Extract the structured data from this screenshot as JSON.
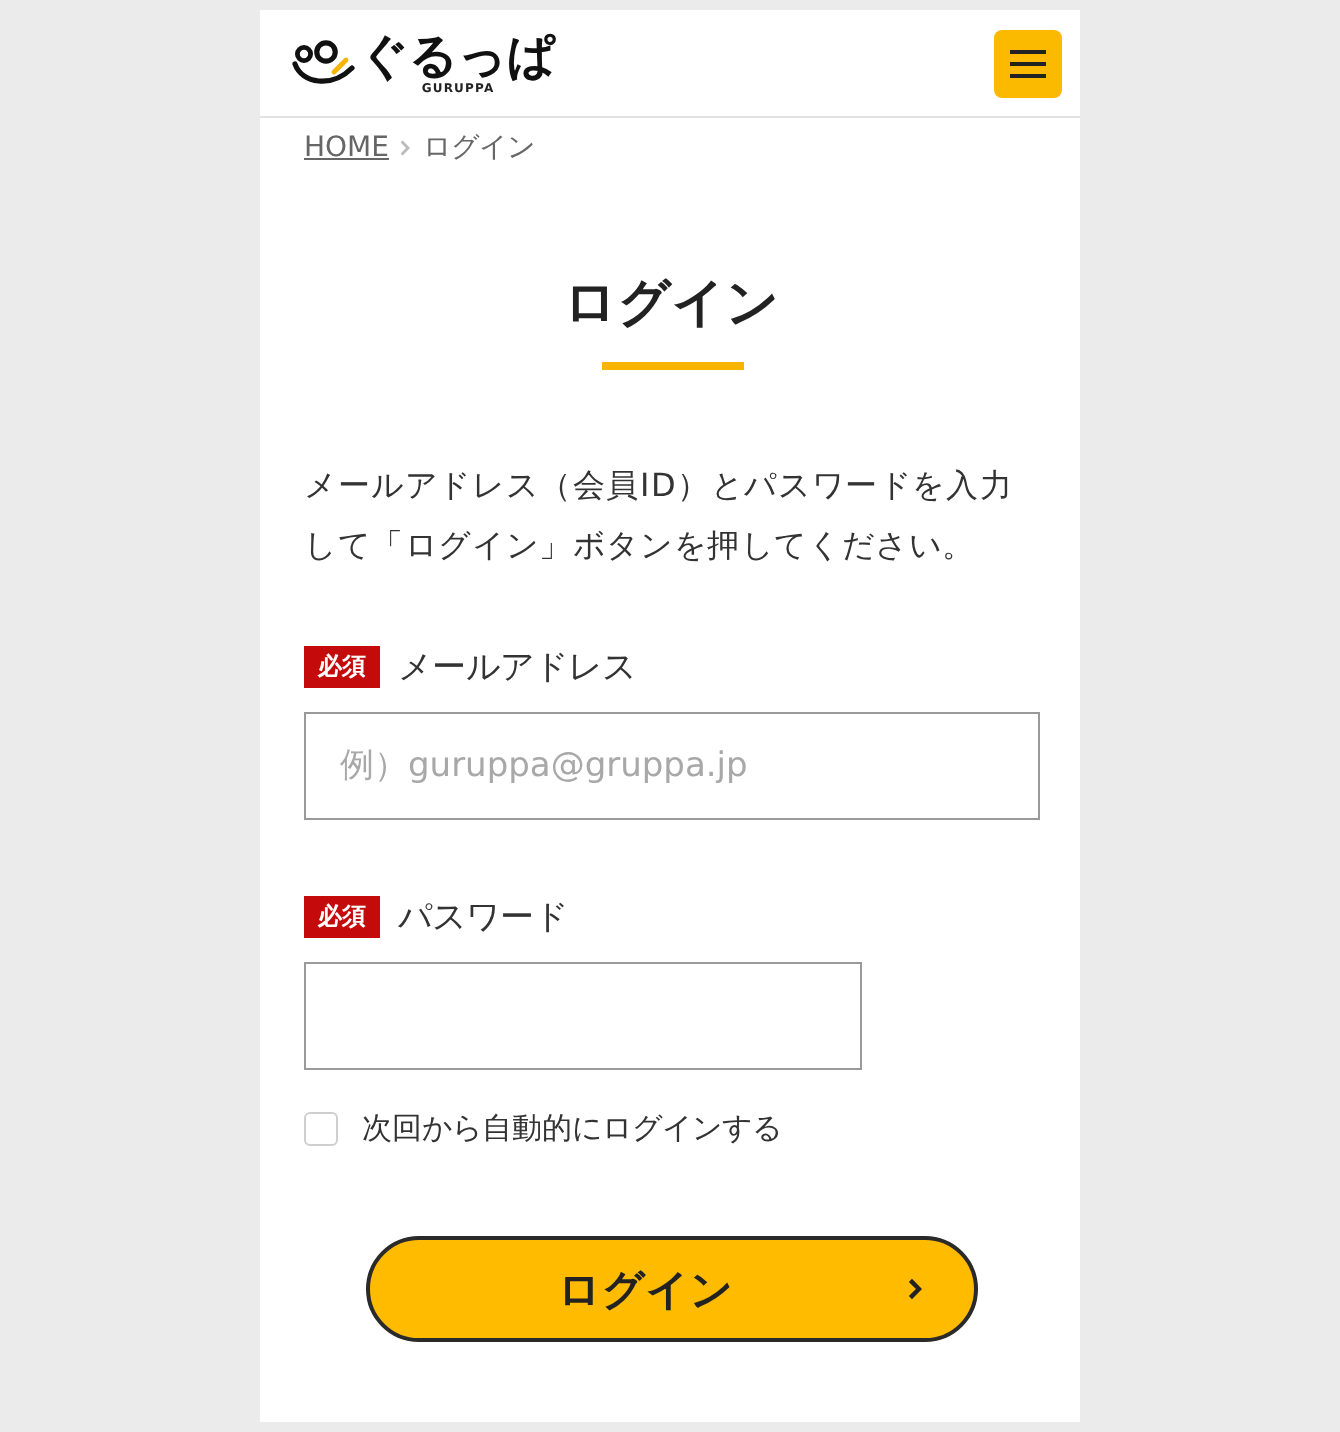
{
  "header": {
    "logo": {
      "text": "ぐるっぱ",
      "subtitle": "GURUPPA"
    }
  },
  "breadcrumb": [
    {
      "label": "HOME",
      "current": false
    },
    {
      "label": "ログイン",
      "current": true
    }
  ],
  "title": "ログイン",
  "intro": "メールアドレス（会員ID）とパスワードを入力して「ログイン」ボタンを押してください。",
  "fields": [
    {
      "kind": "email",
      "badge": "必須",
      "label": "メールアドレス",
      "placeholder": "例）guruppa@gruppa.jp"
    },
    {
      "kind": "password",
      "badge": "必須",
      "label": "パスワード"
    }
  ],
  "remember": {
    "label": "次回から自動的にログインする",
    "checked": false
  },
  "submit": {
    "label": "ログイン"
  }
}
